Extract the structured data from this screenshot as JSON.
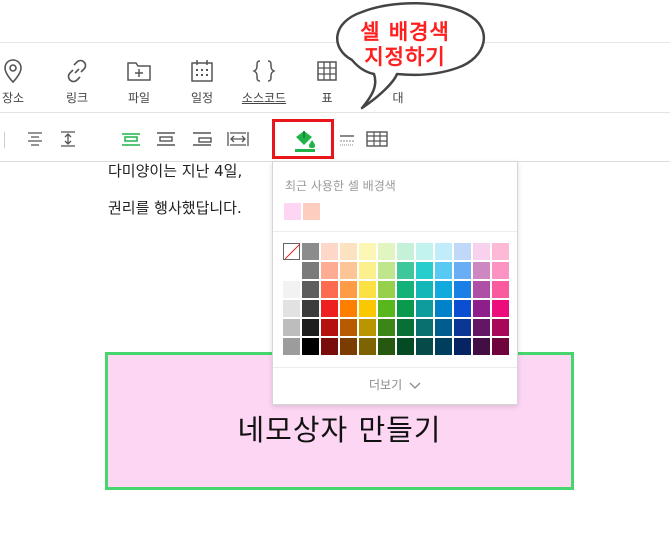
{
  "toolbar": {
    "items": [
      {
        "label": "장소",
        "icon": "map-pin-icon"
      },
      {
        "label": "링크",
        "icon": "link-icon"
      },
      {
        "label": "파일",
        "icon": "folder-add-icon"
      },
      {
        "label": "일정",
        "icon": "calendar-icon"
      },
      {
        "label": "소스코드",
        "icon": "code-braces-icon"
      },
      {
        "label": "표",
        "icon": "table-icon"
      },
      {
        "label": "대",
        "icon": "more-icon"
      }
    ]
  },
  "callout": {
    "line1": "셀 배경색",
    "line2": "지정하기"
  },
  "document": {
    "line1": "다미양이는 지난 4일,",
    "line2": "권리를 행사했답니다."
  },
  "box": {
    "text": "네모상자 만들기",
    "fill": "#fdd6f4",
    "border": "#46d66d"
  },
  "color_popup": {
    "recent_title": "최근 사용한 셀 배경색",
    "recent": [
      "#fdd6f4",
      "#fdcdbf"
    ],
    "more_label": "더보기",
    "palette": [
      [
        "none",
        "#8c8c8c",
        "#fdd7c8",
        "#fde2c2",
        "#fdf7b6",
        "#e1f5c0",
        "#c4f1d7",
        "#c3f3ef",
        "#c1ecfa",
        "#c1d9f9",
        "#f7d1ee",
        "#fdb9d6"
      ],
      [
        "#ffffff",
        "#7a7a7a",
        "#fdab93",
        "#fdc495",
        "#fcf08c",
        "#bfe68d",
        "#3ec79a",
        "#27cdcd",
        "#57c9f2",
        "#69aef4",
        "#cd87c1",
        "#fc93c2"
      ],
      [
        "#f2f2f2",
        "#5e5e5e",
        "#fd6c50",
        "#fe9b46",
        "#fce142",
        "#97d04d",
        "#12b279",
        "#13b7b8",
        "#11aadf",
        "#1b80e6",
        "#ae4fa8",
        "#fa5b9f"
      ],
      [
        "#e2e2e2",
        "#3c3c3c",
        "#ee1f1f",
        "#fe7f00",
        "#fac800",
        "#57b71d",
        "#0a9a4d",
        "#0e9c9c",
        "#0082c8",
        "#0b4fd0",
        "#8e1e8c",
        "#ec0c7b"
      ],
      [
        "#bdbdbd",
        "#1e1e1e",
        "#b5120f",
        "#b85b00",
        "#b99500",
        "#3c8517",
        "#077035",
        "#0a6f6f",
        "#005d8e",
        "#0a3694",
        "#641564",
        "#a8085a"
      ],
      [
        "#9c9c9c",
        "#000000",
        "#7a0d0b",
        "#7b3c00",
        "#7d6400",
        "#275810",
        "#044a23",
        "#064a4a",
        "#003e5e",
        "#062462",
        "#430e43",
        "#70043c"
      ]
    ]
  },
  "colors": {
    "accent_green": "#21b34a",
    "highlight_red": "#e8151b"
  }
}
